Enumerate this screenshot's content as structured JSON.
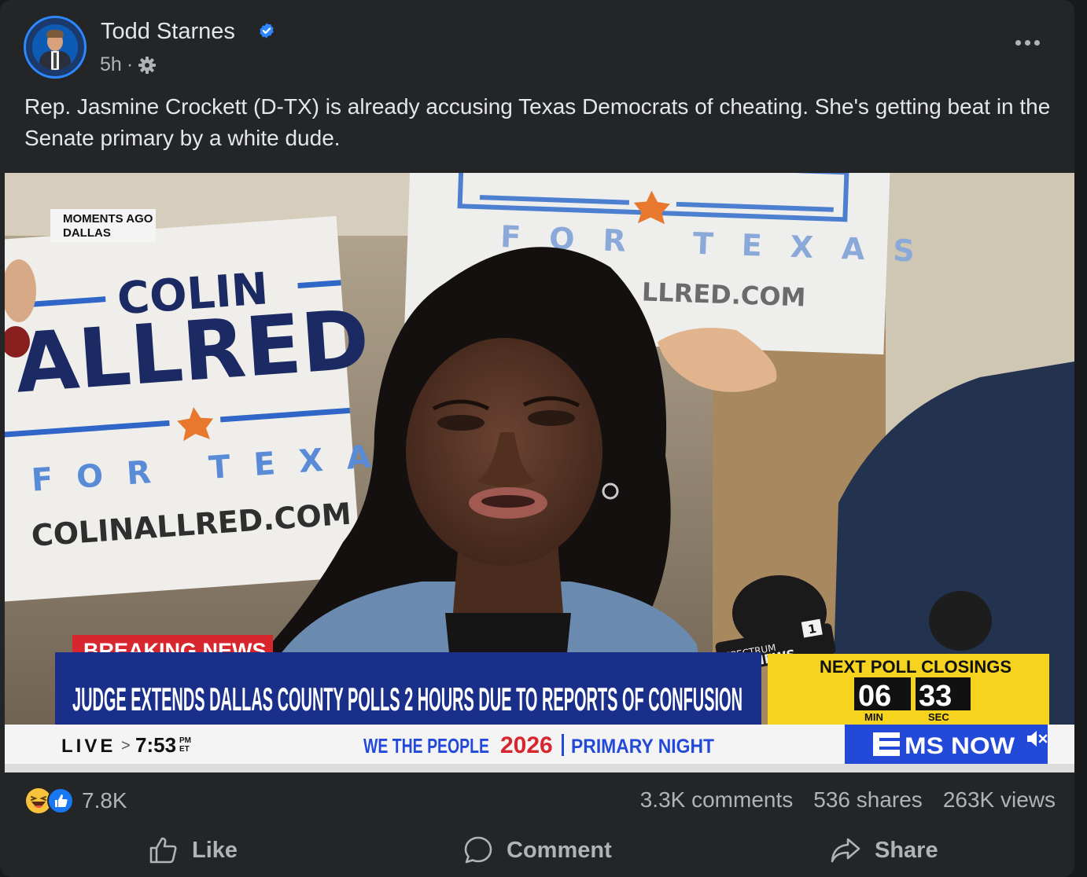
{
  "post": {
    "author": "Todd Starnes",
    "verified": true,
    "time": "5h",
    "separator": "·",
    "audience_icon": "gear-icon",
    "caption": "Rep. Jasmine Crockett (D-TX) is already accusing Texas Democrats of cheating. She's getting beat in the Senate primary by a white dude."
  },
  "video": {
    "location_tag_line1": "MOMENTS AGO",
    "location_tag_line2": "DALLAS",
    "sign_left_line1": "COLIN",
    "sign_left_line2": "ALLRED",
    "sign_left_line3": "FOR TEXAS",
    "sign_left_line4": "COLINALLRED.COM",
    "sign_right_line1": "FOR TEXAS",
    "sign_right_line2": "LLRED.COM",
    "mic_label_1": "SPECTRUM",
    "mic_label_2": "NEWS",
    "mic_label_3": "1",
    "breaking_label": "BREAKING NEWS",
    "headline": "JUDGE EXTENDS DALLAS COUNTY POLLS 2 HOURS DUE TO REPORTS OF CONFUSION",
    "poll_title": "NEXT POLL CLOSINGS",
    "poll_min": "06",
    "poll_sec": "33",
    "poll_min_label": "MIN",
    "poll_sec_label": "SEC",
    "live_label": "LIVE",
    "live_arrow": ">",
    "live_time": "7:53",
    "live_ampm": "PM",
    "live_tz": "ET",
    "program_name": "WE THE PEOPLE",
    "program_year": "2026",
    "program_sub": "PRIMARY NIGHT",
    "network": "MS NOW",
    "mute_icon": "speaker-muted-icon",
    "colors": {
      "breaking_red": "#d7262e",
      "headline_blue": "#1a2f8a",
      "poll_yellow": "#f5d31f",
      "network_blue": "#2349d8"
    }
  },
  "engagement": {
    "reaction_count": "7.8K",
    "comments": "3.3K comments",
    "shares": "536 shares",
    "views": "263K views"
  },
  "actions": {
    "like": "Like",
    "comment": "Comment",
    "share": "Share"
  },
  "colors": {
    "card_bg": "#242526",
    "verified": "#2d88ff",
    "text_primary": "#e4e6eb",
    "text_secondary": "#b0b3b8"
  }
}
